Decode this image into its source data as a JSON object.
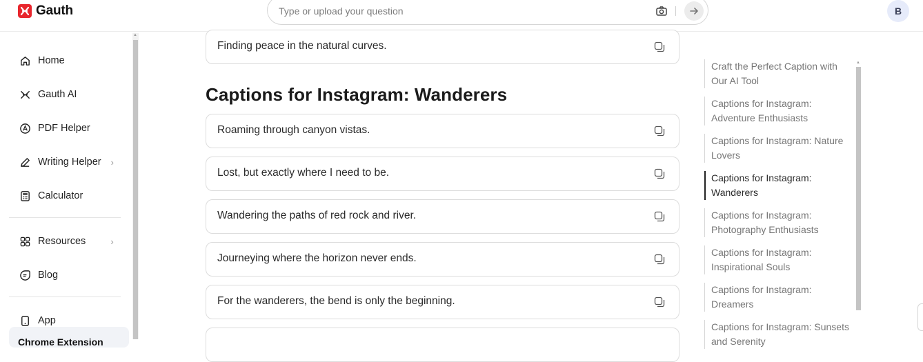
{
  "header": {
    "brand": "Gauth",
    "search_placeholder": "Type or upload your question",
    "avatar_initial": "B"
  },
  "sidebar": {
    "items": [
      {
        "label": "Home",
        "icon": "home-icon"
      },
      {
        "label": "Gauth AI",
        "icon": "gauth-ai-icon"
      },
      {
        "label": "PDF Helper",
        "icon": "pdf-icon"
      },
      {
        "label": "Writing Helper",
        "icon": "pen-icon",
        "has_submenu": true
      },
      {
        "label": "Calculator",
        "icon": "calculator-icon"
      },
      {
        "label": "Resources",
        "icon": "grid-icon",
        "has_submenu": true
      },
      {
        "label": "Blog",
        "icon": "blog-icon"
      },
      {
        "label": "App",
        "icon": "phone-icon"
      }
    ],
    "bottom_text": "Chrome Extension"
  },
  "main": {
    "prev_caption": "Finding peace in the natural curves.",
    "section_title": "Captions for Instagram: Wanderers",
    "captions": [
      "Roaming through canyon vistas.",
      "Lost, but exactly where I need to be.",
      "Wandering the paths of red rock and river.",
      "Journeying where the horizon never ends.",
      "For the wanderers, the bend is only the beginning."
    ]
  },
  "toc": {
    "items": [
      {
        "label": "Craft the Perfect Caption with Our AI Tool"
      },
      {
        "label": "Captions for Instagram: Adventure Enthusiasts"
      },
      {
        "label": "Captions for Instagram: Nature Lovers"
      },
      {
        "label": "Captions for Instagram: Wanderers",
        "active": true
      },
      {
        "label": "Captions for Instagram: Photography Enthusiasts"
      },
      {
        "label": "Captions for Instagram: Inspirational Souls"
      },
      {
        "label": "Captions for Instagram: Dreamers"
      },
      {
        "label": "Captions for Instagram: Sunsets and Serenity"
      }
    ]
  },
  "colors": {
    "brand": "#e8262d",
    "active_toc_border": "#222222"
  }
}
